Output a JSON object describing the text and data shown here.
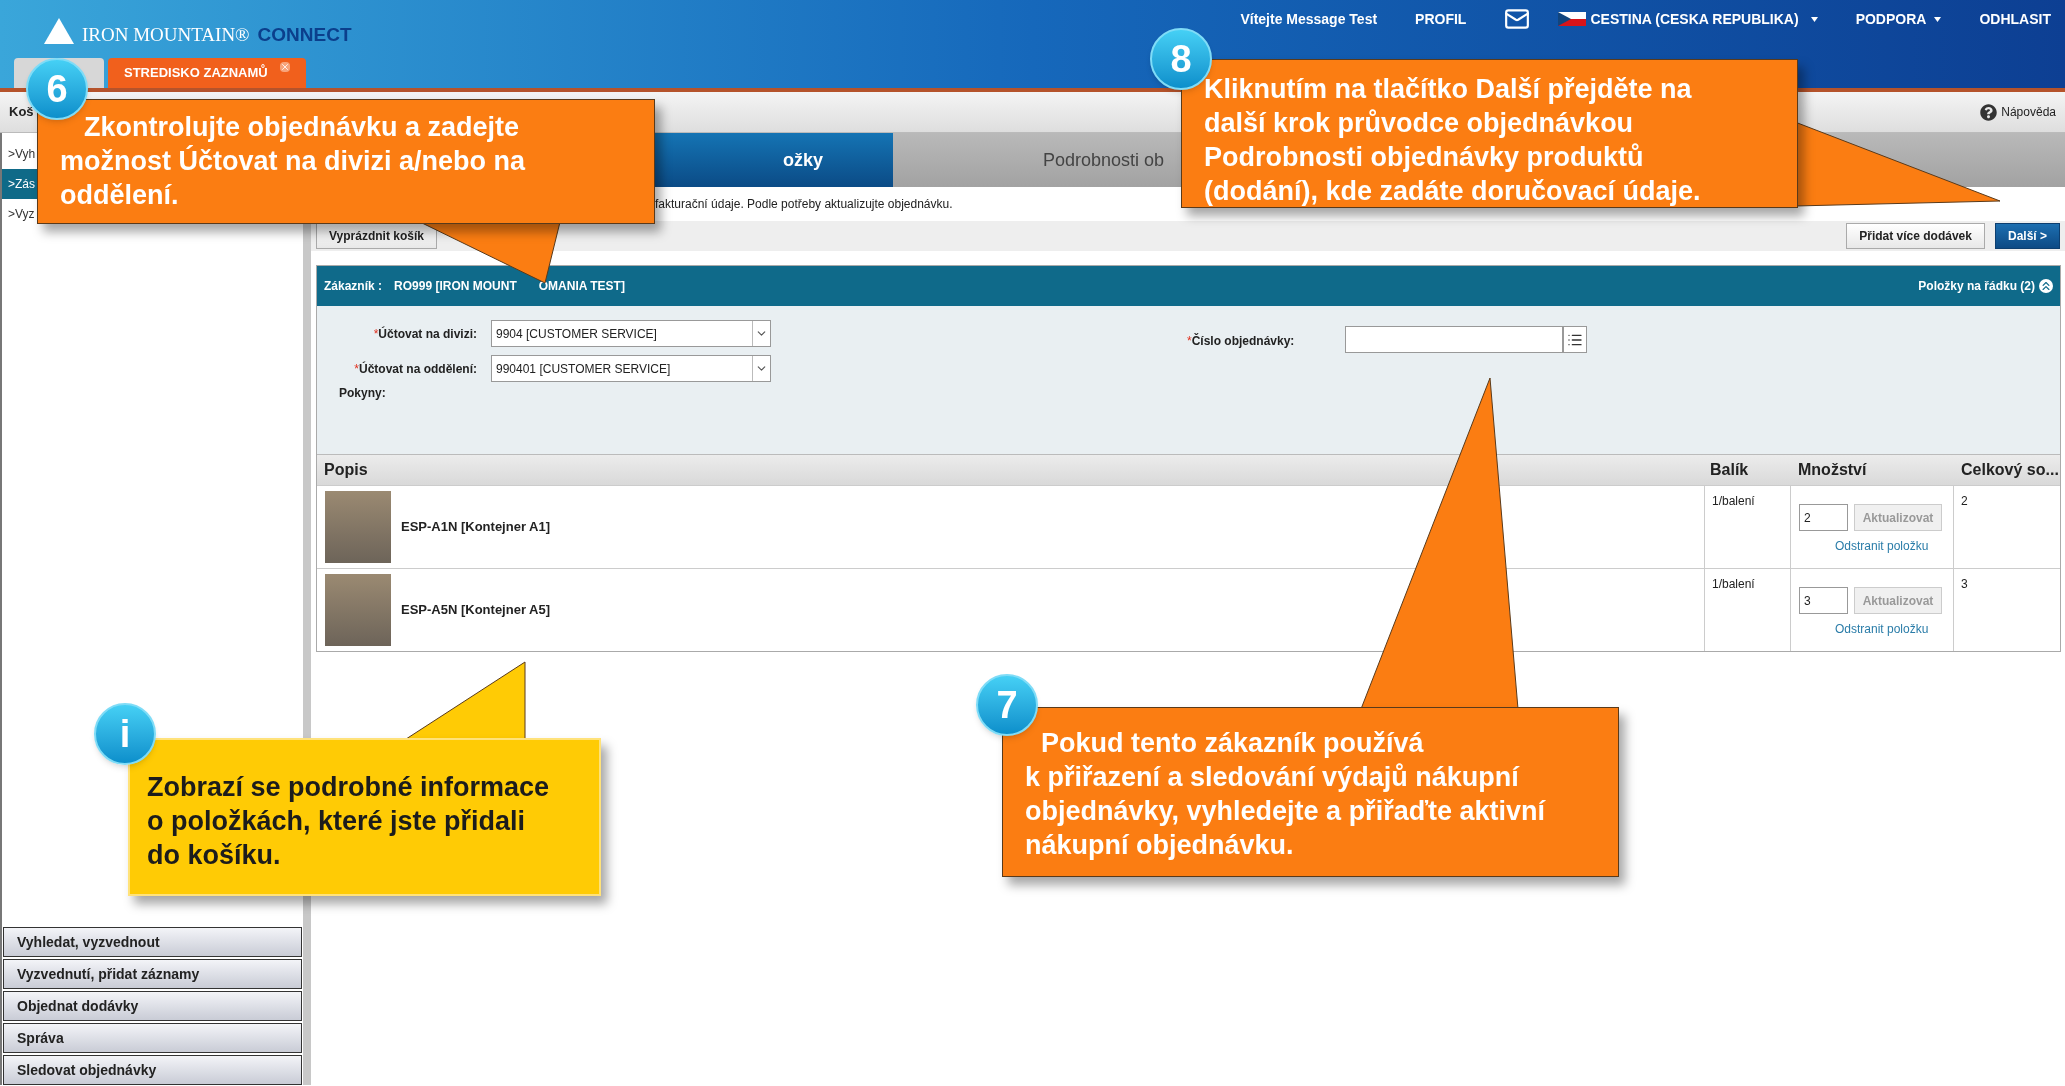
{
  "header": {
    "brand": "IRON MOUNTAIN®",
    "product": "CONNECT"
  },
  "top_nav": [
    {
      "kind": "text",
      "label": "Vítejte Message Test"
    },
    {
      "kind": "link",
      "label": "PROFIL"
    },
    {
      "kind": "mail"
    },
    {
      "kind": "language",
      "label": "CESTINA (CESKA REPUBLIKA)"
    },
    {
      "kind": "menu",
      "label": "PODPORA"
    },
    {
      "kind": "link",
      "label": "ODHLASIT"
    }
  ],
  "tabs": [
    {
      "selected": false
    },
    {
      "label": "STREDISKO ZAZNAMŮ",
      "selected": true,
      "closable": true
    }
  ],
  "breadcrumb": "Koš",
  "help": "Nápověda",
  "sidebar": {
    "items": [
      {
        "label": ">Vyh",
        "selected": false
      },
      {
        "label": ">Zás",
        "selected": true
      },
      {
        "label": ">Vyz",
        "selected": false
      }
    ],
    "menu": [
      "Vyhledat, vyzvednout",
      "Vyzvednutí, přidat záznamy",
      "Objednat dodávky",
      "Správa",
      "Sledovat objednávky"
    ]
  },
  "wizard_steps": [
    {
      "label": "ožky",
      "selected": true
    },
    {
      "label": "Podrobnosti ob",
      "selected": false
    },
    {
      "selected": false
    }
  ],
  "info_text": "fakturační údaje. Podle potřeby aktualizujte objednávku.",
  "toolbar": {
    "left": [
      {
        "label": "Vyprázdnit košík",
        "kind": "secondary"
      }
    ],
    "right": [
      {
        "label": "Přidat více dodávek",
        "kind": "secondary"
      },
      {
        "label": "Další >",
        "kind": "primary"
      }
    ]
  },
  "customer_panel": {
    "label": "Zákazník :",
    "value_parts": [
      "RO999 [IRON MOUNT",
      "OMANIA TEST]"
    ],
    "items_per_row": "Položky na řádku (2)",
    "fields": [
      {
        "mark": "*",
        "label": "Účtovat na divizi:",
        "value": "9904 [CUSTOMER SERVICE]"
      },
      {
        "mark": "*",
        "label": "Účtovat na oddělení:",
        "value": "990401 [CUSTOMER SERVICE]"
      }
    ],
    "notes_label": "Pokyny:",
    "order_number": {
      "mark": "*",
      "label": "Číslo objednávky:"
    }
  },
  "table": {
    "columns": [
      "Popis",
      "Balík",
      "Množství",
      "Celkový so..."
    ],
    "rows": [
      {
        "name": "ESP-A1N [Kontejner A1]",
        "package": "1/balení",
        "quantity": "2",
        "update": "Aktualizovat",
        "remove": "Odstranit položku",
        "total": "2"
      },
      {
        "name": "ESP-A5N [Kontejner A5]",
        "package": "1/balení",
        "quantity": "3",
        "update": "Aktualizovat",
        "remove": "Odstranit položku",
        "total": "3"
      }
    ]
  },
  "callouts": [
    {
      "badge": "6",
      "kind": "orange",
      "lines": [
        "Zkontrolujte objednávku a zadejte",
        "možnost Účtovat na divizi a/nebo na",
        "oddělení."
      ]
    },
    {
      "badge": "8",
      "kind": "orange",
      "lines": [
        "Kliknutím na tlačítko Další přejděte na",
        "další krok průvodce objednávkou",
        "Podrobnosti objednávky produktů",
        "(dodání), kde zadáte doručovací údaje."
      ]
    },
    {
      "badge": "i",
      "kind": "yellow",
      "lines": [
        "Zobrazí se podrobné informace",
        "o položkách, které jste přidali",
        "do košíku."
      ]
    },
    {
      "badge": "7",
      "kind": "orange",
      "lines": [
        "Pokud tento zákazník používá",
        "k přiřazení a sledování výdajů nákupní",
        "objednávky, vyhledejte a přiřaďte aktivní",
        "nákupní objednávku."
      ]
    }
  ]
}
